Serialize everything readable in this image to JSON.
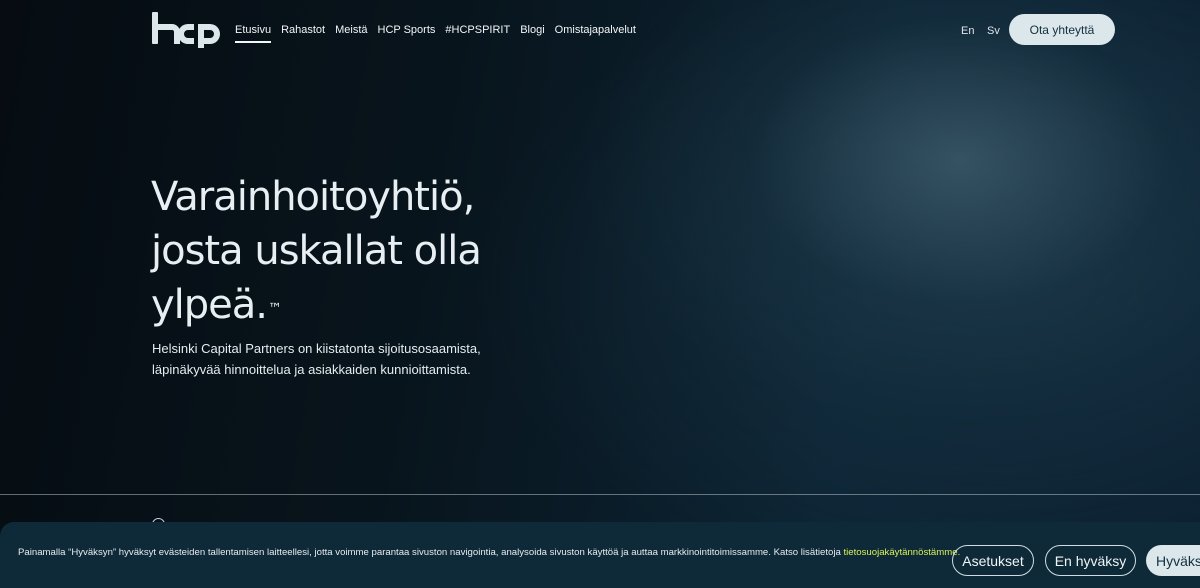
{
  "header": {
    "nav": [
      {
        "label": "Etusivu",
        "active": true
      },
      {
        "label": "Rahastot"
      },
      {
        "label": "Meistä"
      },
      {
        "label": "HCP Sports"
      },
      {
        "label": "#HCPSPIRIT"
      },
      {
        "label": "Blogi"
      },
      {
        "label": "Omistajapalvelut"
      }
    ],
    "lang_en": "En",
    "lang_sv": "Sv",
    "contact_label": "Ota yhteyttä"
  },
  "hero": {
    "title_line1": "Varainhoitoyhtiö,",
    "title_line2": "josta uskallat olla",
    "title_line3": "ylpeä.",
    "trademark": "™",
    "subtitle_line1": "Helsinki Capital Partners on kiistatonta sijoitusosaamista,",
    "subtitle_line2": "läpinäkyvää hinnoittelua ja asiakkaiden kunnioittamista."
  },
  "cookie": {
    "text": "Painamalla “Hyväksyn” hyväksyt evästeiden tallentamisen laitteellesi, jotta voimme parantaa sivuston navigointia, analysoida sivuston käyttöä ja auttaa markkinointitoimissamme. Katso lisätietoja ",
    "link": "tietosuojakäytännöstämme.",
    "settings_label": "Asetukset",
    "reject_label": "En hyväksy",
    "accept_label": "Hyväksyn"
  },
  "colors": {
    "accent_link": "#d8f05a",
    "button_light": "#dbe7ea",
    "banner_bg": "#0e2a38"
  },
  "icons": {
    "logo": "hcp-logo",
    "circle": "circle-icon"
  }
}
